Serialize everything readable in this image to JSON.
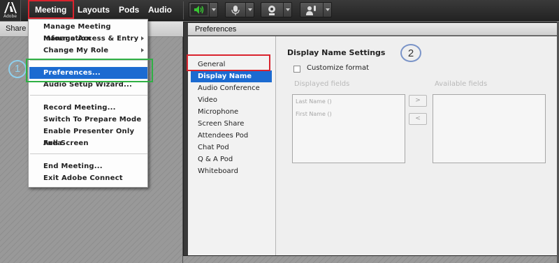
{
  "app": {
    "logo_text": "Adobe",
    "menus": [
      "Meeting",
      "Layouts",
      "Pods",
      "Audio"
    ]
  },
  "toolbar": {
    "speaker_icon": "speaker-on-icon",
    "mic_icon": "microphone-icon",
    "webcam_icon": "webcam-icon",
    "status_icon": "raise-hand-icon",
    "speaker_color": "#39c534"
  },
  "share_pod": {
    "title": "Share",
    "step_marker": "1"
  },
  "meeting_menu": {
    "items": [
      {
        "label": "Manage Meeting Information"
      },
      {
        "label": "Manage Access & Entry"
      },
      {
        "label": "Change My Role"
      },
      {
        "label": "Preferences..."
      },
      {
        "label": "Audio Setup Wizard..."
      },
      {
        "label": "Record Meeting..."
      },
      {
        "label": "Switch To Prepare Mode"
      },
      {
        "label": "Enable Presenter Only Area"
      },
      {
        "label": "Full Screen"
      },
      {
        "label": "End Meeting..."
      },
      {
        "label": "Exit Adobe Connect"
      }
    ],
    "selected": "Preferences..."
  },
  "preferences": {
    "title": "Preferences",
    "nav": [
      "General",
      "Display Name",
      "Audio Conference",
      "Video",
      "Microphone",
      "Screen Share",
      "Attendees Pod",
      "Chat Pod",
      "Q & A Pod",
      "Whiteboard"
    ],
    "selected_nav": "Display Name",
    "settings_title": "Display Name Settings",
    "step_marker": "2",
    "customize_label": "Customize format",
    "customize_checked": false,
    "displayed_header": "Displayed fields",
    "available_header": "Available fields",
    "displayed_fields": [
      "Last Name ()",
      "First Name ()"
    ],
    "available_fields": [],
    "add_button": ">",
    "remove_button": "<"
  },
  "colors": {
    "highlight_red": "#d9232d",
    "highlight_green": "#2fb044",
    "selection_blue": "#1c6bd1"
  }
}
